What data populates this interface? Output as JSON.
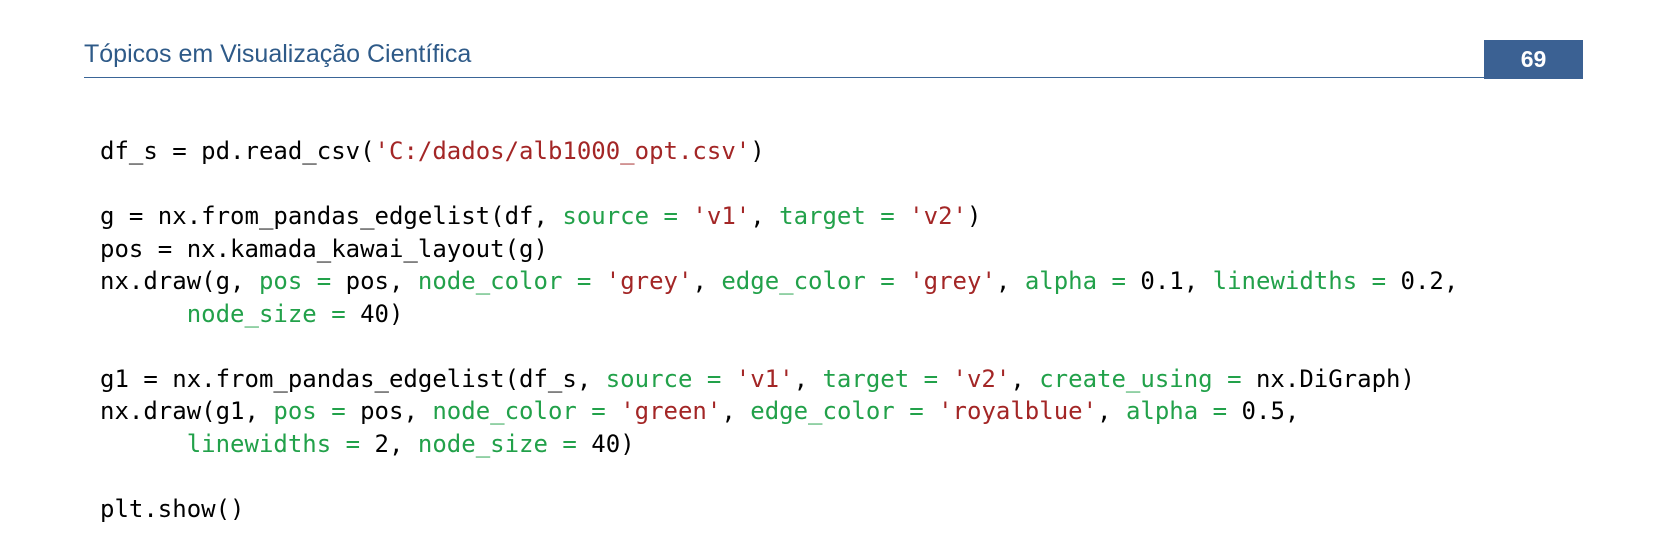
{
  "header": {
    "title": "Tópicos em Visualização Científica",
    "page_number": "69"
  },
  "code": {
    "lines": [
      [
        [
          "p",
          "df_s = pd.read_csv("
        ],
        [
          "s",
          "'C:/dados/alb1000_opt.csv'"
        ],
        [
          "p",
          ")"
        ]
      ],
      [],
      [
        [
          "p",
          "g = nx.from_pandas_edgelist(df, "
        ],
        [
          "k",
          "source = "
        ],
        [
          "s",
          "'v1'"
        ],
        [
          "p",
          ", "
        ],
        [
          "k",
          "target = "
        ],
        [
          "s",
          "'v2'"
        ],
        [
          "p",
          ")"
        ]
      ],
      [
        [
          "p",
          "pos = nx.kamada_kawai_layout(g)"
        ]
      ],
      [
        [
          "p",
          "nx.draw(g, "
        ],
        [
          "k",
          "pos = "
        ],
        [
          "p",
          "pos, "
        ],
        [
          "k",
          "node_color = "
        ],
        [
          "s",
          "'grey'"
        ],
        [
          "p",
          ", "
        ],
        [
          "k",
          "edge_color = "
        ],
        [
          "s",
          "'grey'"
        ],
        [
          "p",
          ", "
        ],
        [
          "k",
          "alpha = "
        ],
        [
          "p",
          "0.1, "
        ],
        [
          "k",
          "linewidths = "
        ],
        [
          "p",
          "0.2,"
        ]
      ],
      [
        [
          "p",
          "      "
        ],
        [
          "k",
          "node_size = "
        ],
        [
          "p",
          "40)"
        ]
      ],
      [],
      [
        [
          "p",
          "g1 = nx.from_pandas_edgelist(df_s, "
        ],
        [
          "k",
          "source = "
        ],
        [
          "s",
          "'v1'"
        ],
        [
          "p",
          ", "
        ],
        [
          "k",
          "target = "
        ],
        [
          "s",
          "'v2'"
        ],
        [
          "p",
          ", "
        ],
        [
          "k",
          "create_using = "
        ],
        [
          "p",
          "nx.DiGraph)"
        ]
      ],
      [
        [
          "p",
          "nx.draw(g1, "
        ],
        [
          "k",
          "pos = "
        ],
        [
          "p",
          "pos, "
        ],
        [
          "k",
          "node_color = "
        ],
        [
          "s",
          "'green'"
        ],
        [
          "p",
          ", "
        ],
        [
          "k",
          "edge_color = "
        ],
        [
          "s",
          "'royalblue'"
        ],
        [
          "p",
          ", "
        ],
        [
          "k",
          "alpha = "
        ],
        [
          "p",
          "0.5,"
        ]
      ],
      [
        [
          "p",
          "      "
        ],
        [
          "k",
          "linewidths = "
        ],
        [
          "p",
          "2, "
        ],
        [
          "k",
          "node_size = "
        ],
        [
          "p",
          "40)"
        ]
      ],
      [],
      [
        [
          "p",
          "plt.show()"
        ]
      ]
    ]
  },
  "colors": {
    "header_blue": "#2e5a88",
    "badge_blue": "#3b6193",
    "keyword_green": "#22a14a",
    "string_red": "#a32626"
  }
}
